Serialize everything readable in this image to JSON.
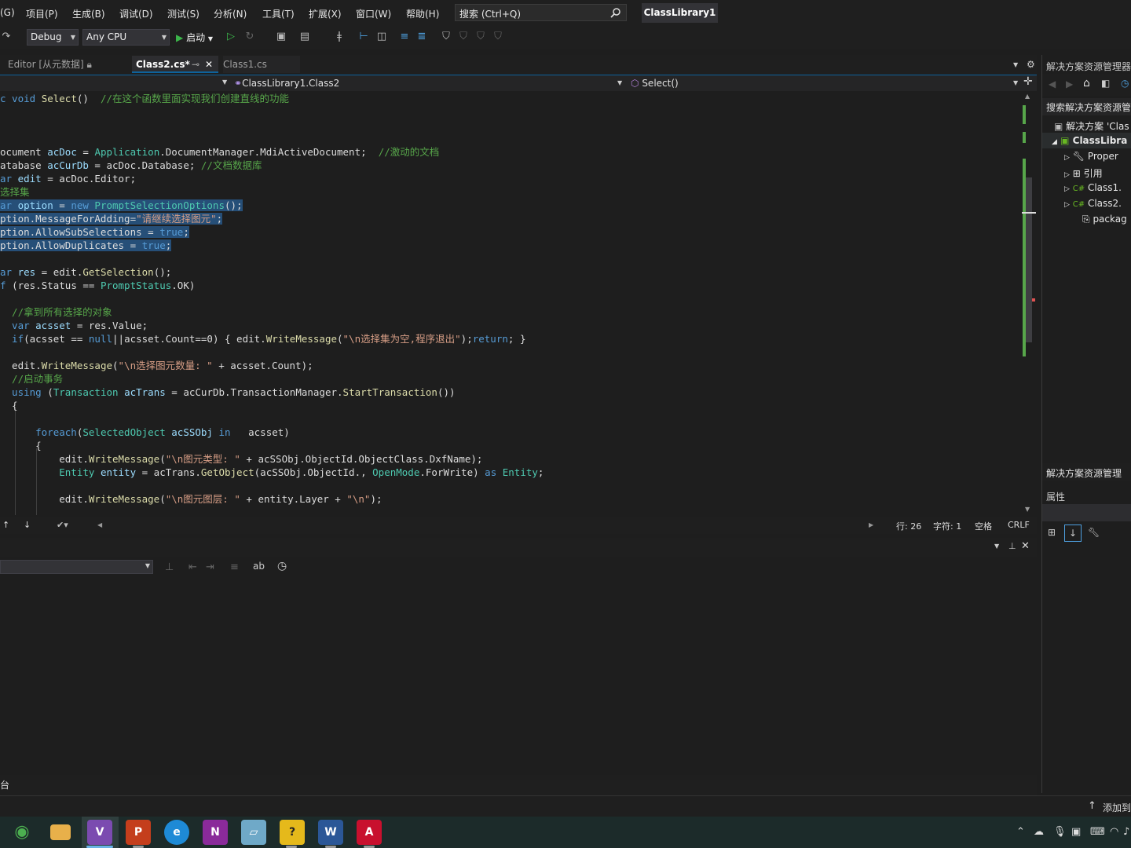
{
  "menubar": {
    "items": [
      "(G)",
      "项目(P)",
      "生成(B)",
      "调试(D)",
      "测试(S)",
      "分析(N)",
      "工具(T)",
      "扩展(X)",
      "窗口(W)",
      "帮助(H)"
    ],
    "search_placeholder": "搜索 (Ctrl+Q)",
    "solution_name": "ClassLibrary1"
  },
  "toolbar": {
    "config": "Debug",
    "platform": "Any CPU",
    "start_label": "启动"
  },
  "tabs": [
    {
      "label": "Editor [从元数据]",
      "active": false
    },
    {
      "label": "Class2.cs*",
      "active": true
    },
    {
      "label": "Class1.cs",
      "active": false
    }
  ],
  "navbar": {
    "type_combo": "ClassLibrary1.Class2",
    "member_combo": "Select()"
  },
  "code_lines": [
    {
      "parts": [
        [
          "kw",
          "c void "
        ],
        [
          "mt",
          "Select"
        ],
        [
          "",
          "() "
        ],
        [
          "cm",
          " //在这个函数里面实现我们创建直线的功能"
        ]
      ]
    },
    {
      "parts": []
    },
    {
      "parts": []
    },
    {
      "parts": []
    },
    {
      "parts": [
        [
          "",
          "ocument "
        ],
        [
          "vr",
          "acDoc"
        ],
        [
          "",
          " = "
        ],
        [
          "ty",
          "Application"
        ],
        [
          "",
          ".DocumentManager.MdiActiveDocument;  "
        ],
        [
          "cm",
          "//激动的文档"
        ]
      ]
    },
    {
      "parts": [
        [
          "",
          "atabase "
        ],
        [
          "vr",
          "acCurDb"
        ],
        [
          "",
          " = acDoc.Database; "
        ],
        [
          "cm",
          "//文档数据库"
        ]
      ]
    },
    {
      "parts": [
        [
          "kw",
          "ar "
        ],
        [
          "vr",
          "edit"
        ],
        [
          "",
          " = acDoc.Editor;"
        ]
      ]
    },
    {
      "parts": [
        [
          "cm",
          "选择集"
        ]
      ]
    },
    {
      "sel": true,
      "parts": [
        [
          "kw",
          "ar "
        ],
        [
          "vr",
          "option"
        ],
        [
          "",
          " = "
        ],
        [
          "kw",
          "new "
        ],
        [
          "ty",
          "PromptSelectionOptions"
        ],
        [
          "",
          "();"
        ]
      ]
    },
    {
      "sel": true,
      "parts": [
        [
          "",
          "ption.MessageForAdding="
        ],
        [
          "st",
          "\"请继续选择图元\""
        ],
        [
          "",
          ";"
        ]
      ]
    },
    {
      "sel": true,
      "parts": [
        [
          "",
          "ption.AllowSubSelections = "
        ],
        [
          "kw",
          "true"
        ],
        [
          "",
          ";"
        ]
      ]
    },
    {
      "sel": true,
      "parts": [
        [
          "",
          "ption.AllowDuplicates = "
        ],
        [
          "kw",
          "true"
        ],
        [
          "",
          ";"
        ]
      ]
    },
    {
      "parts": []
    },
    {
      "parts": [
        [
          "kw",
          "ar "
        ],
        [
          "vr",
          "res"
        ],
        [
          "",
          " = edit."
        ],
        [
          "mt",
          "GetSelection"
        ],
        [
          "",
          "();"
        ]
      ]
    },
    {
      "parts": [
        [
          "kw",
          "f "
        ],
        [
          "",
          "(res.Status == "
        ],
        [
          "ty",
          "PromptStatus"
        ],
        [
          "",
          ".OK)"
        ]
      ]
    },
    {
      "parts": []
    },
    {
      "parts": [
        [
          "cm",
          "  //拿到所有选择的对象"
        ]
      ]
    },
    {
      "parts": [
        [
          "kw",
          "  var "
        ],
        [
          "vr",
          "acsset"
        ],
        [
          "",
          " = res.Value;"
        ]
      ]
    },
    {
      "parts": [
        [
          "kw",
          "  if"
        ],
        [
          "",
          "(acsset == "
        ],
        [
          "kw",
          "null"
        ],
        [
          "",
          "||acsset.Count==0) { edit."
        ],
        [
          "mt",
          "WriteMessage"
        ],
        [
          "",
          "("
        ],
        [
          "st",
          "\"\\n选择集为空,程序退出\""
        ],
        [
          "",
          ");"
        ],
        [
          "kw",
          "return"
        ],
        [
          "",
          "; }"
        ]
      ]
    },
    {
      "parts": []
    },
    {
      "parts": [
        [
          "",
          "  edit."
        ],
        [
          "mt",
          "WriteMessage"
        ],
        [
          "",
          "("
        ],
        [
          "st",
          "\"\\n选择图元数量: \""
        ],
        [
          "",
          " + acsset.Count);"
        ]
      ]
    },
    {
      "parts": [
        [
          "cm",
          "  //启动事务"
        ]
      ]
    },
    {
      "parts": [
        [
          "kw",
          "  using "
        ],
        [
          "",
          "("
        ],
        [
          "ty",
          "Transaction"
        ],
        [
          "",
          " "
        ],
        [
          "vr",
          "acTrans"
        ],
        [
          "",
          " = acCurDb.TransactionManager."
        ],
        [
          "mt",
          "StartTransaction"
        ],
        [
          "",
          "())"
        ]
      ]
    },
    {
      "parts": [
        [
          "",
          "  {"
        ]
      ]
    },
    {
      "parts": []
    },
    {
      "parts": [
        [
          "kw",
          "      foreach"
        ],
        [
          "",
          "("
        ],
        [
          "ty",
          "SelectedObject"
        ],
        [
          "",
          " "
        ],
        [
          "vr",
          "acSSObj"
        ],
        [
          "kw",
          " in "
        ],
        [
          "",
          "  acsset)"
        ]
      ]
    },
    {
      "parts": [
        [
          "",
          "      {"
        ]
      ]
    },
    {
      "parts": [
        [
          "",
          "          edit."
        ],
        [
          "mt",
          "WriteMessage"
        ],
        [
          "",
          "("
        ],
        [
          "st",
          "\"\\n图元类型: \""
        ],
        [
          "",
          " + acSSObj.ObjectId.ObjectClass.DxfName);"
        ]
      ]
    },
    {
      "parts": [
        [
          "ty",
          "          Entity"
        ],
        [
          "",
          " "
        ],
        [
          "vr",
          "entity"
        ],
        [
          "",
          " = acTrans."
        ],
        [
          "mt",
          "GetObject"
        ],
        [
          "",
          "(acSSObj.ObjectId., "
        ],
        [
          "ty",
          "OpenMode"
        ],
        [
          "",
          ".ForWrite) "
        ],
        [
          "kw",
          "as "
        ],
        [
          "ty",
          "Entity"
        ],
        [
          "",
          ";"
        ]
      ]
    },
    {
      "parts": []
    },
    {
      "parts": [
        [
          "",
          "          edit."
        ],
        [
          "mt",
          "WriteMessage"
        ],
        [
          "",
          "("
        ],
        [
          "st",
          "\"\\n图元图层: \""
        ],
        [
          "",
          " + entity.Layer + "
        ],
        [
          "st",
          "\"\\n\""
        ],
        [
          "",
          ");"
        ]
      ]
    }
  ],
  "editor_status": {
    "line": "行: 26",
    "char": "字符: 1",
    "spaces": "空格",
    "eol": "CRLF"
  },
  "bottom_tab_label": "台",
  "statusbar": {
    "add_label": "添加到"
  },
  "right_panel": {
    "title": "解决方案资源管理器",
    "search_placeholder": "搜索解决方案资源管",
    "tree": [
      {
        "label": "解决方案 'Clas",
        "depth": 0
      },
      {
        "label": "ClassLibra",
        "depth": 1
      },
      {
        "label": "Proper",
        "depth": 2
      },
      {
        "label": "引用",
        "depth": 2
      },
      {
        "label": "Class1.",
        "depth": 2
      },
      {
        "label": "Class2.",
        "depth": 2
      },
      {
        "label": "packag",
        "depth": 2
      }
    ],
    "bottom_title": "解决方案资源管理",
    "properties_title": "属性"
  },
  "taskbar": {
    "apps": [
      "browser-360",
      "file-explorer",
      "visual-studio",
      "powerpoint",
      "edge",
      "onenote-like",
      "notepad",
      "help-tool",
      "word",
      "autocad"
    ]
  },
  "colors": {
    "accent": "#0e639c",
    "background": "#1e1e1e",
    "selection": "#264f78"
  }
}
